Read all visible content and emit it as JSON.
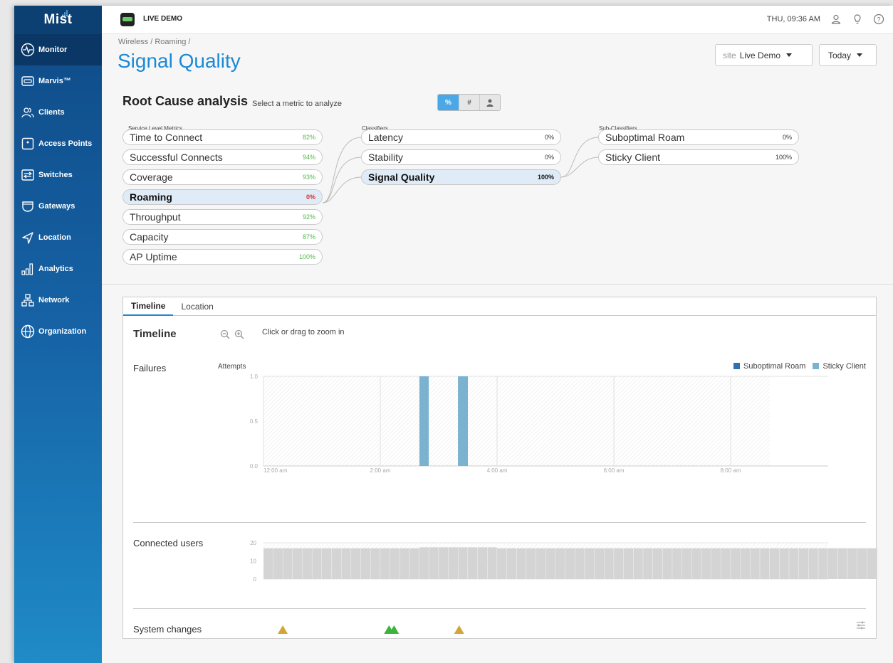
{
  "sidebar": {
    "logo": "Mist",
    "items": [
      {
        "label": "Monitor",
        "icon": "monitor-icon"
      },
      {
        "label": "Marvis™",
        "icon": "marvis-icon"
      },
      {
        "label": "Clients",
        "icon": "clients-icon"
      },
      {
        "label": "Access Points",
        "icon": "access-point-icon"
      },
      {
        "label": "Switches",
        "icon": "switch-icon"
      },
      {
        "label": "Gateways",
        "icon": "gateway-icon"
      },
      {
        "label": "Location",
        "icon": "location-icon"
      },
      {
        "label": "Analytics",
        "icon": "analytics-icon"
      },
      {
        "label": "Network",
        "icon": "network-icon"
      },
      {
        "label": "Organization",
        "icon": "organization-icon"
      }
    ]
  },
  "topbar": {
    "org_name": "LIVE DEMO",
    "datetime": "THU, 09:36 AM"
  },
  "header": {
    "breadcrumb": "Wireless / Roaming /",
    "title": "Signal Quality",
    "site_label": "site",
    "site_value": "Live Demo",
    "date_value": "Today"
  },
  "rca": {
    "title": "Root Cause analysis",
    "hint": "Select a metric to analyze",
    "toggles": [
      "%",
      "#",
      "user"
    ],
    "service_label": "Service Level Metrics",
    "classifier_label": "Classifiers",
    "subclassifier_label": "Sub-Classifiers",
    "service_metrics": [
      {
        "name": "Time to Connect",
        "value": "82%"
      },
      {
        "name": "Successful Connects",
        "value": "94%"
      },
      {
        "name": "Coverage",
        "value": "93%"
      },
      {
        "name": "Roaming",
        "value": "0%"
      },
      {
        "name": "Throughput",
        "value": "92%"
      },
      {
        "name": "Capacity",
        "value": "87%"
      },
      {
        "name": "AP Uptime",
        "value": "100%"
      }
    ],
    "classifiers": [
      {
        "name": "Latency",
        "value": "0%"
      },
      {
        "name": "Stability",
        "value": "0%"
      },
      {
        "name": "Signal Quality",
        "value": "100%"
      }
    ],
    "subclassifiers": [
      {
        "name": "Suboptimal Roam",
        "value": "0%"
      },
      {
        "name": "Sticky Client",
        "value": "100%"
      }
    ],
    "colors": {
      "good": "#55b84f",
      "bad": "#d93030",
      "accent": "#1a8ad6"
    }
  },
  "timeline": {
    "tabs": [
      "Timeline",
      "Location"
    ],
    "title": "Timeline",
    "hint": "Click or drag to zoom in",
    "failures_label": "Failures",
    "attempts_label": "Attempts",
    "connected_label": "Connected users",
    "system_label": "System changes",
    "legend": [
      {
        "name": "Suboptimal Roam",
        "color": "#2f6fb4"
      },
      {
        "name": "Sticky Client",
        "color": "#7ab2d0"
      }
    ]
  },
  "chart_data": [
    {
      "type": "bar",
      "ylabel": "Attempts",
      "ylim": [
        0,
        1.0
      ],
      "y_ticks": [
        "1.0",
        "0.5",
        "0.0"
      ],
      "x_ticks": [
        "12:00 am",
        "2:00 am",
        "4:00 am",
        "6:00 am",
        "8:00 am"
      ],
      "x_range_hours": [
        0,
        9.67
      ],
      "data_end_hour": 8.67,
      "series": [
        {
          "name": "Suboptimal Roam",
          "color": "#2f6fb4",
          "points": []
        },
        {
          "name": "Sticky Client",
          "color": "#7ab2d0",
          "points": [
            {
              "start_hour": 2.67,
              "end_hour": 2.83,
              "value": 1.0
            },
            {
              "start_hour": 3.33,
              "end_hour": 3.5,
              "value": 1.0
            }
          ]
        }
      ]
    },
    {
      "type": "bar",
      "title": "Connected users",
      "ylim": [
        0,
        20
      ],
      "y_ticks": [
        "20",
        "10",
        "0"
      ],
      "x_range_hours": [
        0,
        9.67
      ],
      "bucket_hours": 0.1667,
      "values": [
        17,
        17,
        17,
        17,
        17,
        17,
        17,
        17,
        17,
        17,
        17,
        17,
        17,
        17,
        17,
        17,
        17.5,
        17.5,
        17.5,
        17.5,
        17.5,
        17.5,
        17.5,
        17.5,
        17,
        17,
        17,
        17,
        17,
        17,
        17,
        17,
        17,
        17,
        17,
        17,
        17,
        17,
        17,
        17,
        17,
        17,
        17,
        17,
        17,
        17,
        17,
        17,
        17,
        17,
        17,
        17,
        17,
        17,
        17,
        17,
        17,
        17,
        17,
        17,
        17,
        17,
        17,
        17,
        16,
        16,
        16,
        16,
        16,
        16,
        16,
        16,
        16,
        16,
        16,
        16,
        16,
        16,
        15.5,
        15.5,
        16,
        16,
        16,
        16,
        16,
        16,
        16,
        16,
        16,
        16,
        16,
        16,
        16,
        16,
        16,
        16,
        16,
        16,
        16,
        16,
        16,
        16,
        16,
        16,
        16,
        16,
        16,
        16,
        16,
        16,
        16,
        16,
        16,
        16,
        16,
        16,
        16,
        16,
        16,
        16,
        16,
        16,
        16,
        16,
        16,
        16,
        16,
        16,
        16,
        16,
        16,
        16,
        16,
        16,
        16,
        16,
        16,
        16,
        16,
        16,
        16,
        16,
        16,
        16,
        16,
        16,
        16,
        16,
        16,
        16,
        16,
        16,
        16,
        16,
        16,
        16,
        16,
        16,
        16,
        16,
        16,
        16,
        16,
        16,
        17,
        17,
        17,
        17,
        17,
        17,
        17,
        17,
        17,
        16,
        16,
        16,
        16,
        16,
        15
      ],
      "color": "#d4d4d4"
    },
    {
      "type": "scatter",
      "title": "System changes",
      "events": [
        {
          "hour": 0.33,
          "color": "#d4a43a",
          "count": 1
        },
        {
          "hour": 2.15,
          "color": "#3db33d",
          "count": 2
        },
        {
          "hour": 3.35,
          "color": "#d4a43a",
          "count": 1
        }
      ]
    }
  ]
}
